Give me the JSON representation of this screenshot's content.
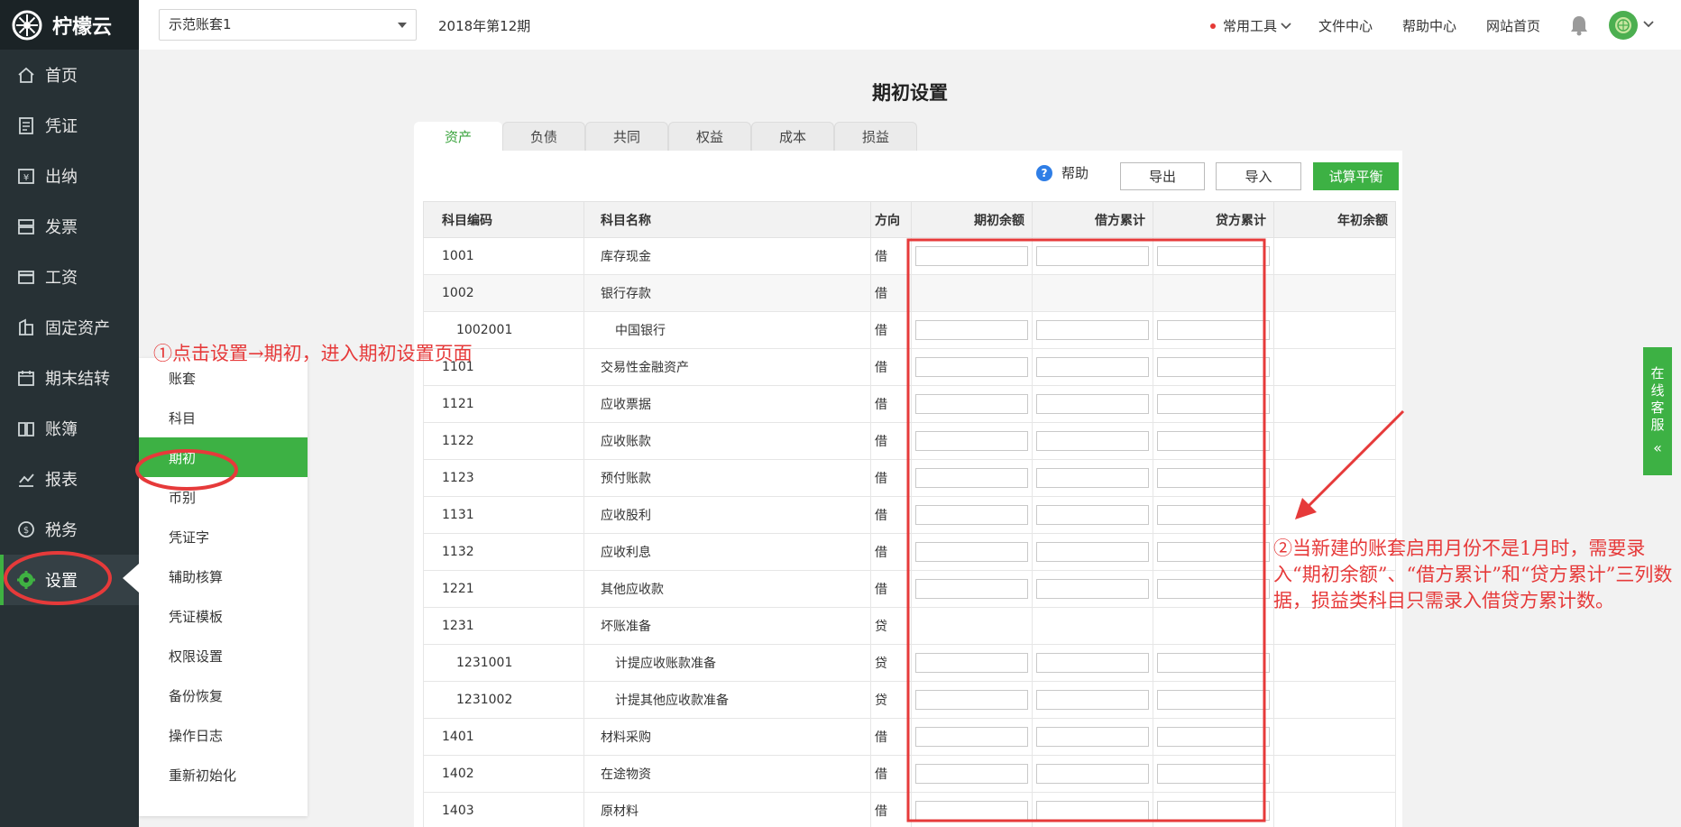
{
  "app": {
    "brand": "柠檬云"
  },
  "sidebar": {
    "items": [
      {
        "label": "首页",
        "icon": "home-icon"
      },
      {
        "label": "凭证",
        "icon": "voucher-icon"
      },
      {
        "label": "出纳",
        "icon": "cashier-icon"
      },
      {
        "label": "发票",
        "icon": "invoice-icon"
      },
      {
        "label": "工资",
        "icon": "salary-icon"
      },
      {
        "label": "固定资产",
        "icon": "fixed-asset-icon"
      },
      {
        "label": "期末结转",
        "icon": "period-close-icon"
      },
      {
        "label": "账簿",
        "icon": "ledger-icon"
      },
      {
        "label": "报表",
        "icon": "report-icon"
      },
      {
        "label": "税务",
        "icon": "tax-icon"
      },
      {
        "label": "设置",
        "icon": "gear-icon",
        "active": true
      }
    ]
  },
  "header": {
    "account": "示范账套1",
    "period": "2018年第12期",
    "tools": "常用工具",
    "links": [
      "文件中心",
      "帮助中心",
      "网站首页"
    ]
  },
  "page": {
    "title": "期初设置",
    "tabs": [
      "资产",
      "负债",
      "共同",
      "权益",
      "成本",
      "损益"
    ],
    "active_tab": "资产",
    "help": "帮助",
    "export": "导出",
    "import": "导入",
    "trial_balance": "试算平衡"
  },
  "table": {
    "headers": [
      "科目编码",
      "科目名称",
      "方向",
      "期初余额",
      "借方累计",
      "贷方累计",
      "年初余额"
    ],
    "rows": [
      {
        "code": "1001",
        "name": "库存现金",
        "dir": "借"
      },
      {
        "code": "1002",
        "name": "银行存款",
        "dir": "借"
      },
      {
        "code": "1002001",
        "name": "中国银行",
        "dir": "借"
      },
      {
        "code": "1101",
        "name": "交易性金融资产",
        "dir": "借"
      },
      {
        "code": "1121",
        "name": "应收票据",
        "dir": "借"
      },
      {
        "code": "1122",
        "name": "应收账款",
        "dir": "借"
      },
      {
        "code": "1123",
        "name": "预付账款",
        "dir": "借"
      },
      {
        "code": "1131",
        "name": "应收股利",
        "dir": "借"
      },
      {
        "code": "1132",
        "name": "应收利息",
        "dir": "借"
      },
      {
        "code": "1221",
        "name": "其他应收款",
        "dir": "借"
      },
      {
        "code": "1231",
        "name": "坏账准备",
        "dir": "贷"
      },
      {
        "code": "1231001",
        "name": "计提应收账款准备",
        "dir": "贷"
      },
      {
        "code": "1231002",
        "name": "计提其他应收款准备",
        "dir": "贷"
      },
      {
        "code": "1401",
        "name": "材料采购",
        "dir": "借"
      },
      {
        "code": "1402",
        "name": "在途物资",
        "dir": "借"
      },
      {
        "code": "1403",
        "name": "原材料",
        "dir": "借"
      }
    ]
  },
  "settings_menu": {
    "items": [
      "账套",
      "科目",
      "期初",
      "币别",
      "凭证字",
      "辅助核算",
      "凭证模板",
      "权限设置",
      "备份恢复",
      "操作日志",
      "重新初始化"
    ],
    "active": "期初"
  },
  "chat": {
    "label": "在线客服"
  },
  "annotations": {
    "step1": "①点击设置→期初，进入期初设置页面",
    "step2": "②当新建的账套启用月份不是1月时，需要录入“期初余额”、“借方累计”和“贷方累计”三列数据，损益类科目只需录入借贷方累计数。"
  },
  "colors": {
    "accent": "#3db144",
    "sidebar": "#273135",
    "annotation": "#e63a3a"
  }
}
